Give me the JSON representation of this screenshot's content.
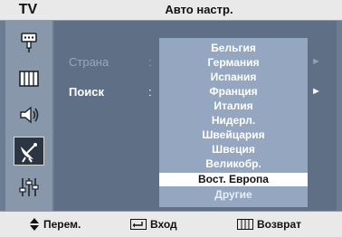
{
  "header": {
    "mode_label": "TV",
    "title": "Авто настр."
  },
  "sidebar": {
    "items": [
      {
        "icon": "input-plug-icon"
      },
      {
        "icon": "picture-grid-icon"
      },
      {
        "icon": "speaker-icon"
      },
      {
        "icon": "satellite-dish-icon",
        "active": true
      },
      {
        "icon": "settings-sliders-icon"
      }
    ]
  },
  "menu": {
    "rows": [
      {
        "label": "Страна",
        "separator": ":",
        "state": "disabled"
      },
      {
        "label": "Поиск",
        "separator": ":",
        "state": "enabled"
      }
    ],
    "arrow": "►"
  },
  "dropdown": {
    "options": [
      "Бельгия",
      "Германия",
      "Испания",
      "Франция",
      "Италия",
      "Нидерл.",
      "Швейцария",
      "Швеция",
      "Великобр.",
      "Вост. Европа",
      "Другие"
    ],
    "selected": "Вост. Европа"
  },
  "footer": {
    "move_label": "Перем.",
    "enter_label": "Вход",
    "return_label": "Возврат"
  },
  "colors": {
    "panel": "#5f6f86",
    "sidebar": "#8997aa",
    "dropdown": "#95a6c0",
    "bars": "#e9e9e9",
    "selection": "#ffffff"
  }
}
